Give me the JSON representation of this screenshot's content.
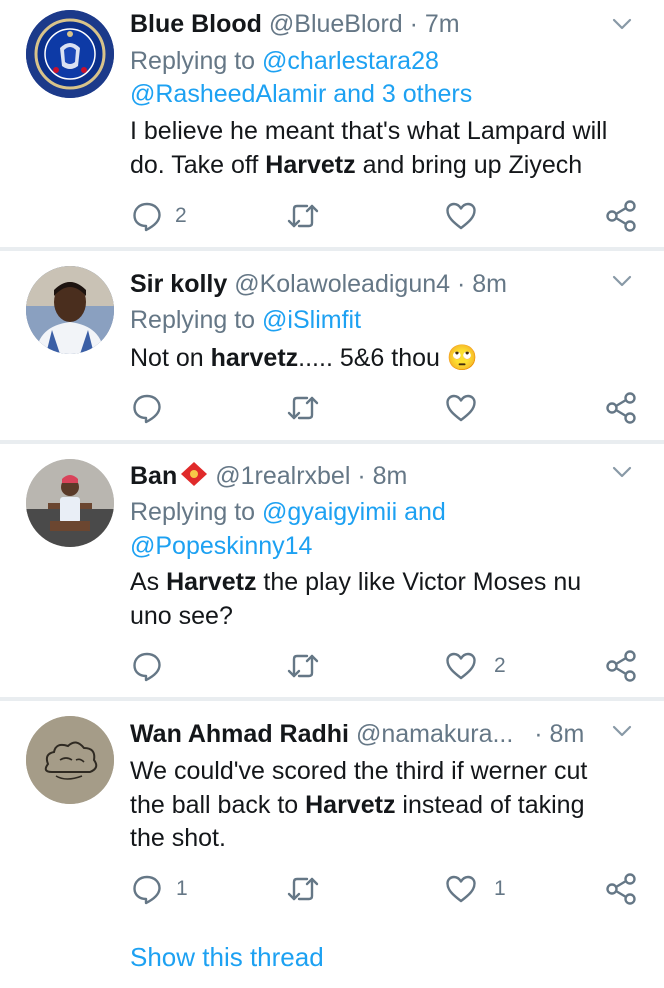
{
  "tweets": [
    {
      "display_name": "Blue Blood",
      "handle": "@BlueBlord",
      "time": "· 7m",
      "reply_prefix": "Replying to",
      "reply_line1_users": "@charlestara28",
      "reply_line2_users": "@RasheedAlamir and 3 others",
      "body_line1": "I believe he meant that's what Lampard will",
      "body_line2_pre": "do. Take off ",
      "body_line2_bold": "Harvetz",
      "body_line2_post": " and bring up Ziyech",
      "reply_count": "2",
      "like_count": ""
    },
    {
      "display_name": "Sir kolly",
      "handle": "@Kolawoleadigun4",
      "time": "· 8m",
      "reply_prefix": "Replying to",
      "reply_line1_users": "@iSlimfit",
      "body_line1_pre": "Not on ",
      "body_line1_bold": "harvetz",
      "body_line1_post": "..... 5&6 thou",
      "emoji": "🙄"
    },
    {
      "display_name": "Ban",
      "handle": "@1realrxbel",
      "time": "· 8m",
      "reply_prefix": "Replying to",
      "reply_line1_users": "@gyaigyimii and",
      "reply_line2_users": "@Popeskinny14",
      "body_line1_pre": "As ",
      "body_line1_bold": "Harvetz",
      "body_line1_post": " the play like Victor Moses nu",
      "body_line2": "uno see?",
      "like_count": "2"
    },
    {
      "display_name": "Wan Ahmad Radhi",
      "handle": "@namakura...",
      "time": "· 8m",
      "body_line1": "We could've scored the third if werner cut",
      "body_line2_pre": "the ball back to ",
      "body_line2_bold": "Harvetz",
      "body_line2_post": " instead of taking",
      "body_line3": "the shot.",
      "reply_count": "1",
      "like_count": "1"
    }
  ],
  "show_thread": "Show this thread",
  "colors": {
    "accent": "#1da1f2",
    "muted": "#657786",
    "text": "#14171a",
    "separator": "#e9edf0"
  },
  "icons": [
    "reply-icon",
    "retweet-icon",
    "like-icon",
    "share-icon",
    "chevron-down-icon"
  ]
}
